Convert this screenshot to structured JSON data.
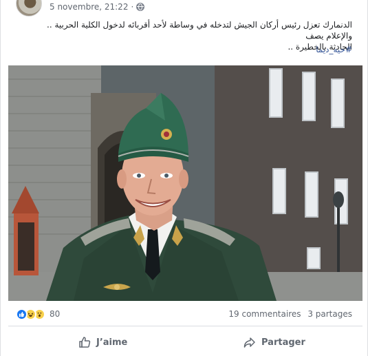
{
  "post": {
    "timestamp": "5 novembre, 21:22",
    "separator": "·",
    "audience_icon": "globe-icon",
    "text_line1": "الدنمارك تعزل رئيس أركان الجيش لتدخله في وساطة لأحد أقربائه لدخول الكلية الحربية .. والإعلام يصف",
    "text_line2": "الحادثة بالخطيرة ..",
    "hashtag": "#حيه_ديما"
  },
  "reactions": {
    "icons": [
      "like-icon",
      "haha-icon",
      "wow-icon"
    ],
    "count": "80",
    "comments": "19 commentaires",
    "shares": "3 partages"
  },
  "actions": {
    "like_label": "J’aime",
    "share_label": "Partager"
  },
  "colors": {
    "link": "#385898",
    "like_blue": "#1877f2",
    "muted": "#616770"
  }
}
